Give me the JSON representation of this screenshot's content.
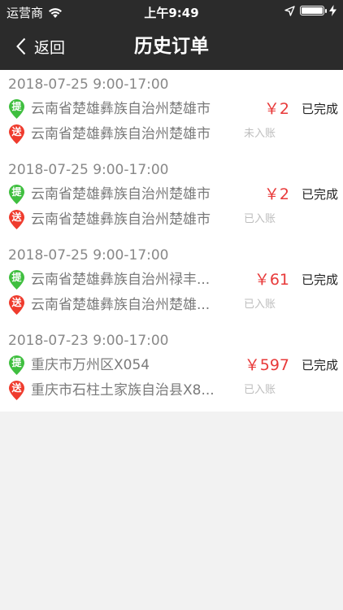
{
  "status_bar": {
    "carrier": "运营商",
    "time": "上午9:49",
    "battery_level": 1.0
  },
  "nav": {
    "back_label": "返回",
    "title": "历史订单"
  },
  "colors": {
    "header_bg": "#2b2b2b",
    "pickup_pin": "#3fbf3f",
    "delivery_pin": "#ef3b2d",
    "price": "#e83a3a"
  },
  "orders": [
    {
      "date": "2018-07-25 9:00-17:00",
      "pickup_tag": "提",
      "pickup_address": "云南省楚雄彝族自治州楚雄市",
      "price": "￥2",
      "status": "已完成",
      "delivery_tag": "送",
      "delivery_address": "云南省楚雄彝族自治州楚雄市",
      "account": "未入账"
    },
    {
      "date": "2018-07-25 9:00-17:00",
      "pickup_tag": "提",
      "pickup_address": "云南省楚雄彝族自治州楚雄市",
      "price": "￥2",
      "status": "已完成",
      "delivery_tag": "送",
      "delivery_address": "云南省楚雄彝族自治州楚雄市",
      "account": "已入账"
    },
    {
      "date": "2018-07-25 9:00-17:00",
      "pickup_tag": "提",
      "pickup_address": "云南省楚雄彝族自治州禄丰...",
      "price": "￥61",
      "status": "已完成",
      "delivery_tag": "送",
      "delivery_address": "云南省楚雄彝族自治州楚雄...",
      "account": "已入账"
    },
    {
      "date": "2018-07-23 9:00-17:00",
      "pickup_tag": "提",
      "pickup_address": "重庆市万州区X054",
      "price": "￥597",
      "status": "已完成",
      "delivery_tag": "送",
      "delivery_address": "重庆市石柱土家族自治县X8...",
      "account": "已入账"
    }
  ]
}
